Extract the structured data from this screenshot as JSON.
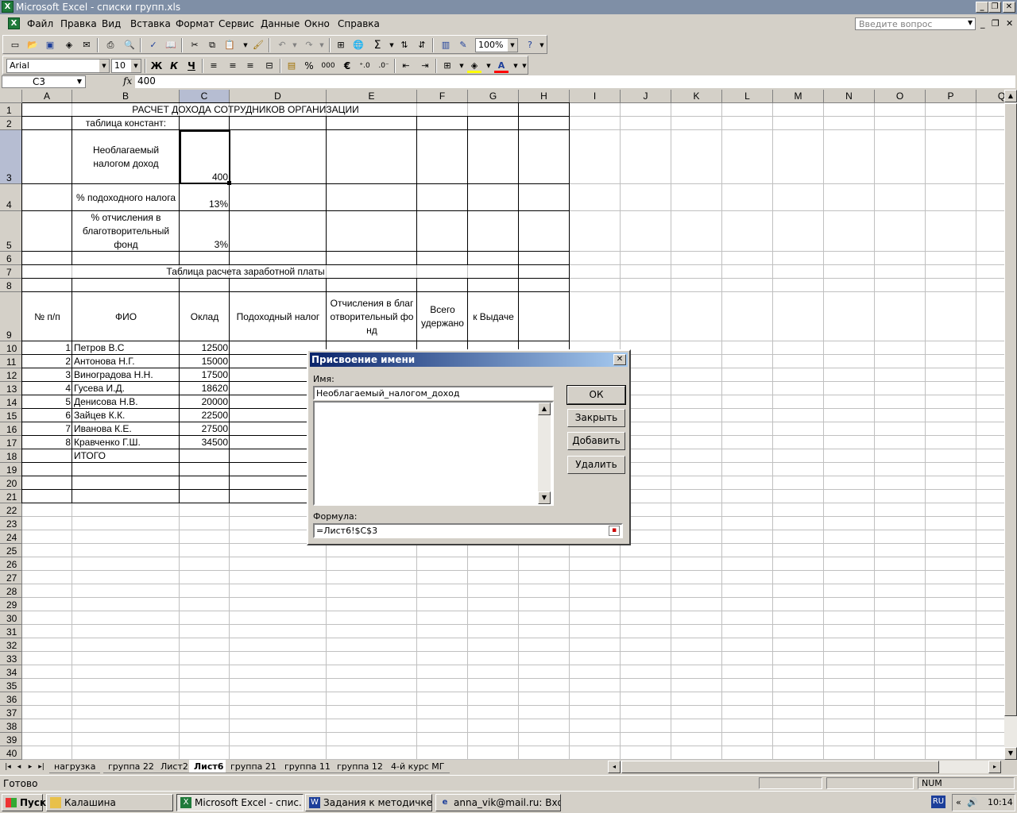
{
  "window": {
    "title": "Microsoft Excel - списки групп.xls"
  },
  "menu": {
    "items": [
      "Файл",
      "Правка",
      "Вид",
      "Вставка",
      "Формат",
      "Сервис",
      "Данные",
      "Окно",
      "Справка"
    ],
    "help_placeholder": "Введите вопрос"
  },
  "toolbar": {
    "font": "Arial",
    "size": "10",
    "zoom": "100%",
    "bold": "Ж",
    "italic": "К",
    "underline": "Ч",
    "percent": "%",
    "thousands": "000",
    "euro": "€",
    "sigma": "Σ"
  },
  "formula_bar": {
    "cell_ref": "C3",
    "fx": "fx",
    "value": "400"
  },
  "columns": [
    "A",
    "B",
    "C",
    "D",
    "E",
    "F",
    "G",
    "H",
    "I",
    "J",
    "K",
    "L",
    "M",
    "N",
    "O",
    "P",
    "Q"
  ],
  "rows": [
    "1",
    "2",
    "3",
    "4",
    "5",
    "6",
    "7",
    "8",
    "9",
    "10",
    "11",
    "12",
    "13",
    "14",
    "15",
    "16",
    "17",
    "18",
    "19",
    "20",
    "21",
    "22",
    "23",
    "24",
    "25",
    "26",
    "27",
    "28",
    "29",
    "30",
    "31",
    "32",
    "33",
    "34",
    "35",
    "36",
    "37",
    "38",
    "39",
    "40"
  ],
  "sheet": {
    "title": "РАСЧЕТ ДОХОДА СОТРУДНИКОВ ОРГАНИЗАЦИИ",
    "constants_label": "таблица констант:",
    "c3_label": "Необлагаемый налогом доход",
    "c3_value": "400",
    "c4_label": "% подоходного налога",
    "c4_value": "13%",
    "c5_label": "% отчисления в благотворительный фонд",
    "c5_value": "3%",
    "table_title": "Таблица расчета заработной платы",
    "headers": [
      "№ п/п",
      "ФИО",
      "Оклад",
      "Подоходный налог",
      "Отчисления в благотворительный фонд",
      "Всего удержано",
      "к Выдаче"
    ],
    "employees": [
      {
        "n": "1",
        "name": "Петров В.С",
        "salary": "12500"
      },
      {
        "n": "2",
        "name": "Антонова Н.Г.",
        "salary": "15000"
      },
      {
        "n": "3",
        "name": "Виноградова Н.Н.",
        "salary": "17500"
      },
      {
        "n": "4",
        "name": "Гусева И.Д.",
        "salary": "18620"
      },
      {
        "n": "5",
        "name": "Денисова Н.В.",
        "salary": "20000"
      },
      {
        "n": "6",
        "name": "Зайцев К.К.",
        "salary": "22500"
      },
      {
        "n": "7",
        "name": "Иванова К.Е.",
        "salary": "27500"
      },
      {
        "n": "8",
        "name": "Кравченко Г.Ш.",
        "salary": "34500"
      }
    ],
    "total_label": "ИТОГО"
  },
  "tabs": {
    "items": [
      "нагрузка",
      "группа 22",
      "Лист2",
      "Лист6",
      "группа 21",
      "группа 11",
      "группа 12",
      "4-й курс МГ"
    ],
    "active": "Лист6"
  },
  "status": {
    "ready": "Готово",
    "num": "NUM"
  },
  "dialog": {
    "title": "Присвоение имени",
    "name_label": "Имя:",
    "name_value": "Необлагаемый_налогом_доход",
    "formula_label": "Формула:",
    "formula_value": "=Лист6!$C$3",
    "ok": "ОК",
    "close": "Закрыть",
    "add": "Добавить",
    "delete": "Удалить"
  },
  "taskbar": {
    "start": "Пуск",
    "tasks": [
      "Калашина",
      "Microsoft Excel - спис...",
      "Задания к методичке.d...",
      "anna_vik@mail.ru: Вход..."
    ],
    "lang": "RU",
    "time": "10:14"
  }
}
